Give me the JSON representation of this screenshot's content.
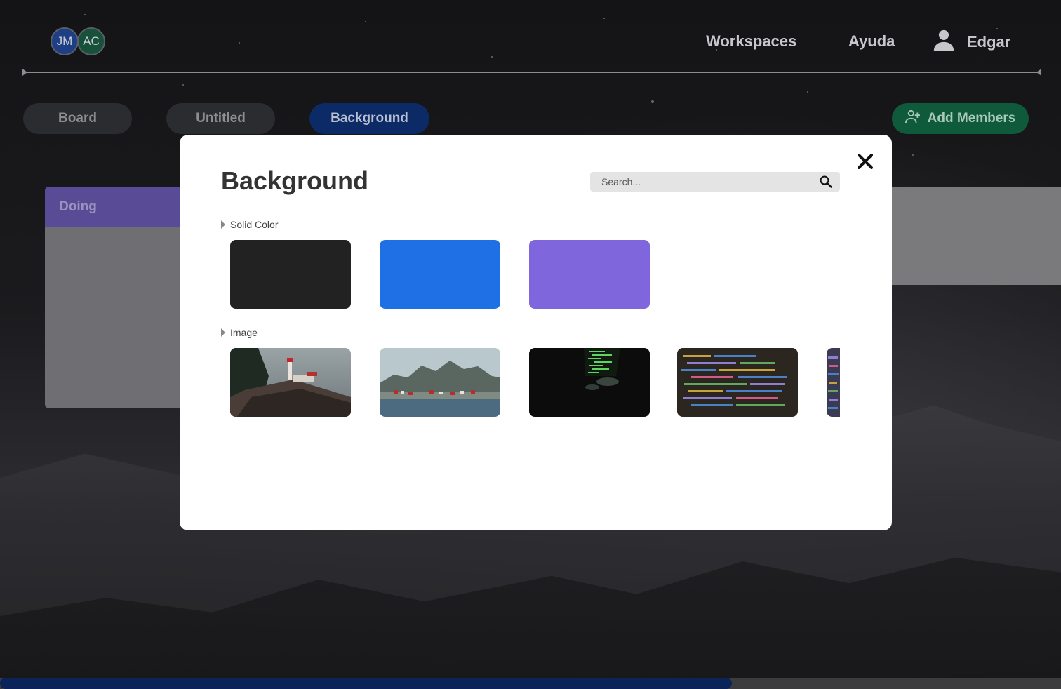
{
  "header": {
    "avatars": [
      {
        "initials": "JM",
        "color": "#1e3f86"
      },
      {
        "initials": "AC",
        "color": "#17513a"
      }
    ],
    "nav": {
      "workspaces": "Workspaces",
      "help": "Ayuda",
      "user_name": "Edgar"
    }
  },
  "tabs": [
    {
      "label": "Board",
      "active": false
    },
    {
      "label": "Untitled",
      "active": false
    },
    {
      "label": "Background",
      "active": true
    }
  ],
  "actions": {
    "add_members": "Add Members"
  },
  "board": {
    "list_title": "Doing"
  },
  "modal": {
    "title": "Background",
    "search": {
      "placeholder": "Search...",
      "value": ""
    },
    "sections": {
      "solid": {
        "label": "Solid Color",
        "colors": [
          "#222222",
          "#1f6fe5",
          "#8066dd"
        ]
      },
      "image": {
        "label": "Image",
        "thumbnails": [
          "lighthouse",
          "fishing-village",
          "hacker-laptop",
          "code-screen",
          "code-screen-partial"
        ]
      }
    }
  },
  "icons": {
    "user": "user-icon",
    "add_user": "add-user-icon",
    "search": "search-icon",
    "close": "close-icon",
    "caret": "caret-right-icon"
  },
  "colors": {
    "accent": "#0b2a66",
    "add_members_bg": "#0f5a3b",
    "modal_bg": "#ffffff",
    "list_header": "#5a4b96"
  }
}
